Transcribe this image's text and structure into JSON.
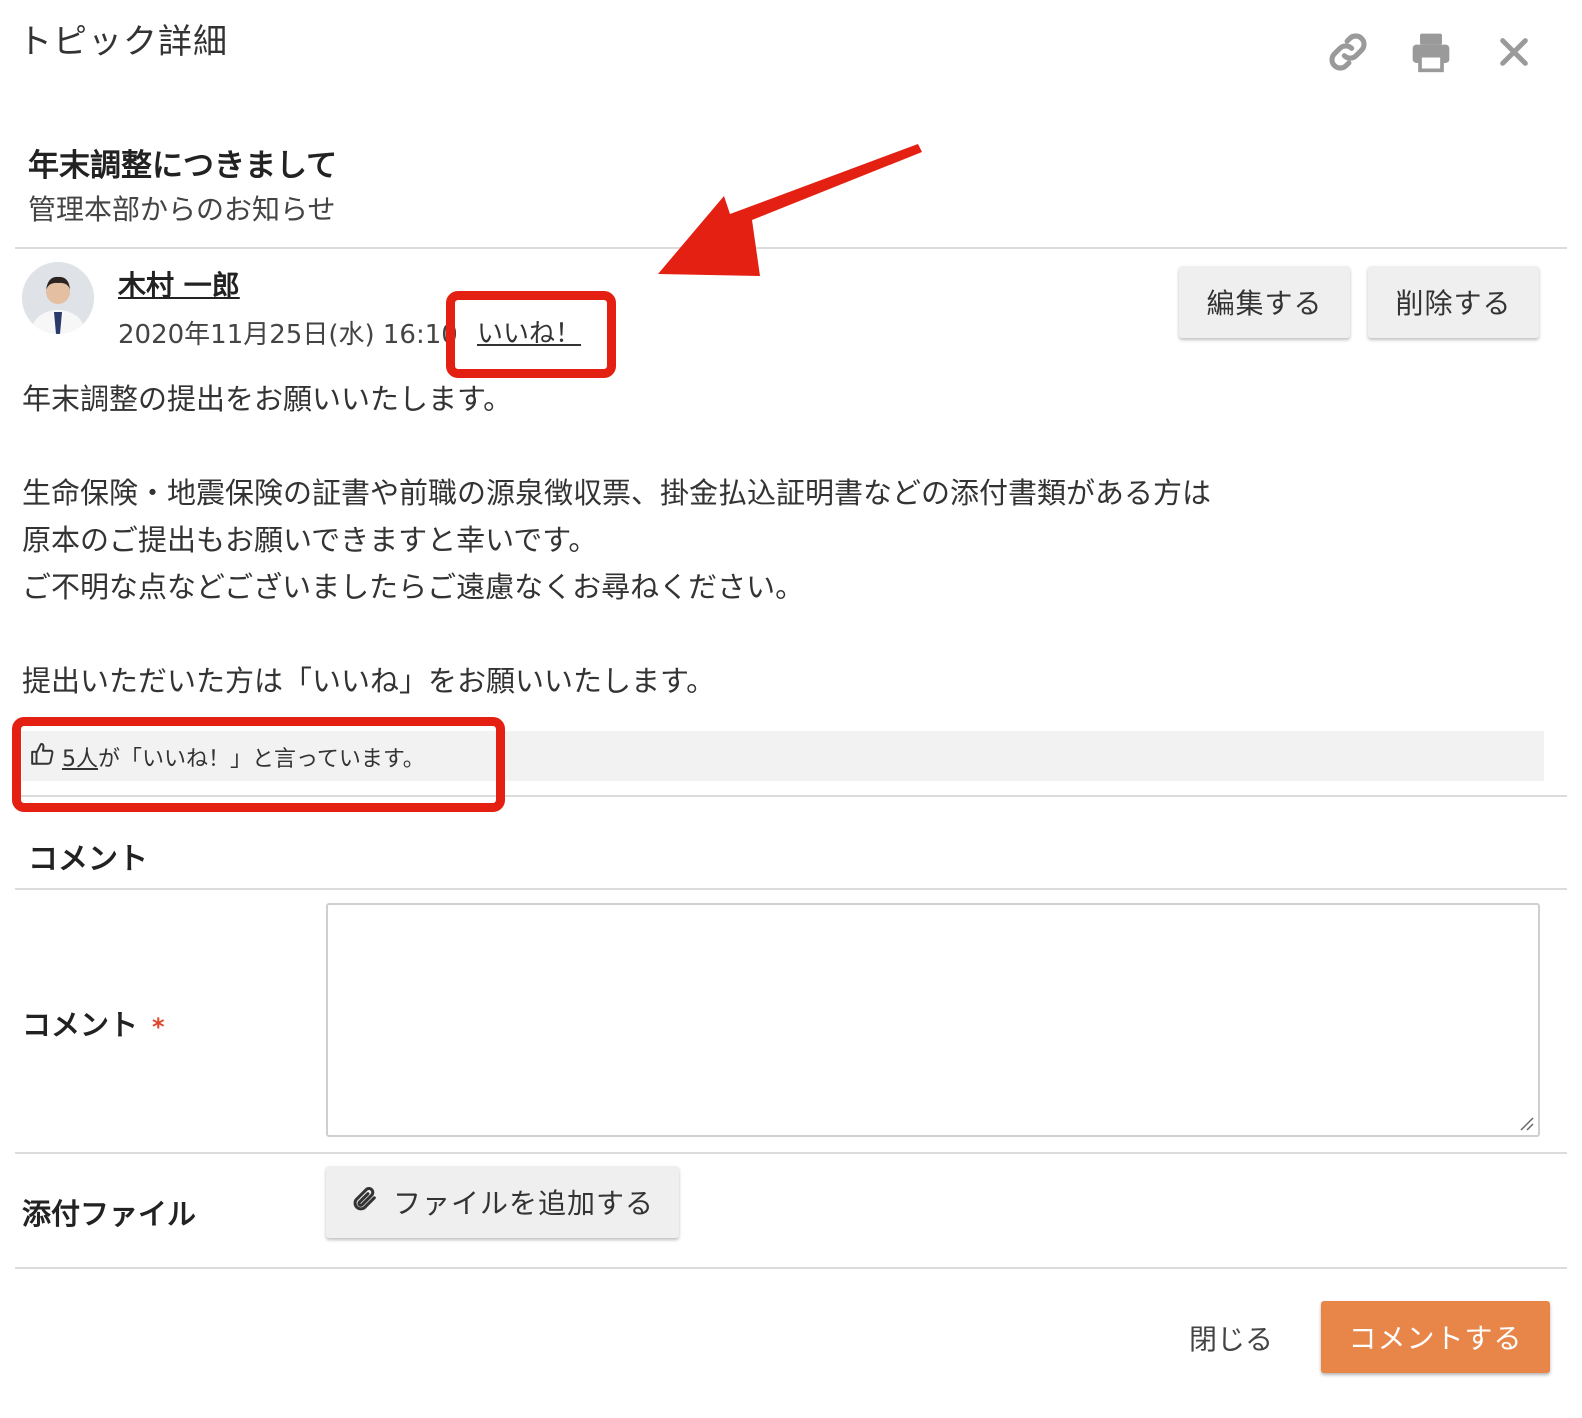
{
  "header": {
    "title": "トピック詳細",
    "icons": [
      "link-icon",
      "print-icon",
      "close-icon"
    ]
  },
  "topic": {
    "title": "年末調整につきまして",
    "subtitle": "管理本部からのお知らせ"
  },
  "post": {
    "author": "木村 一郎",
    "datetime": "2020年11月25日(水) 16:10",
    "like_link": "いいね！",
    "edit_label": "編集する",
    "delete_label": "削除する",
    "body": "年末調整の提出をお願いいたします。\n\n生命保険・地震保険の証書や前職の源泉徴収票、掛金払込証明書などの添付書類がある方は\n原本のご提出もお願いできますと幸いです。\nご不明な点などございましたらご遠慮なくお尋ねください。\n\n提出いただいた方は「いいね」をお願いいたします。"
  },
  "likes": {
    "count": "5人",
    "suffix": "が「いいね！」と言っています。"
  },
  "comments": {
    "section_title": "コメント",
    "comment_label": "コメント",
    "required_mark": "*",
    "attachment_label": "添付ファイル",
    "add_file_label": "ファイルを追加する"
  },
  "footer": {
    "close_label": "閉じる",
    "submit_label": "コメントする"
  },
  "colors": {
    "accent": "#e8864a",
    "annotation": "#e32012",
    "required": "#e0452a"
  }
}
